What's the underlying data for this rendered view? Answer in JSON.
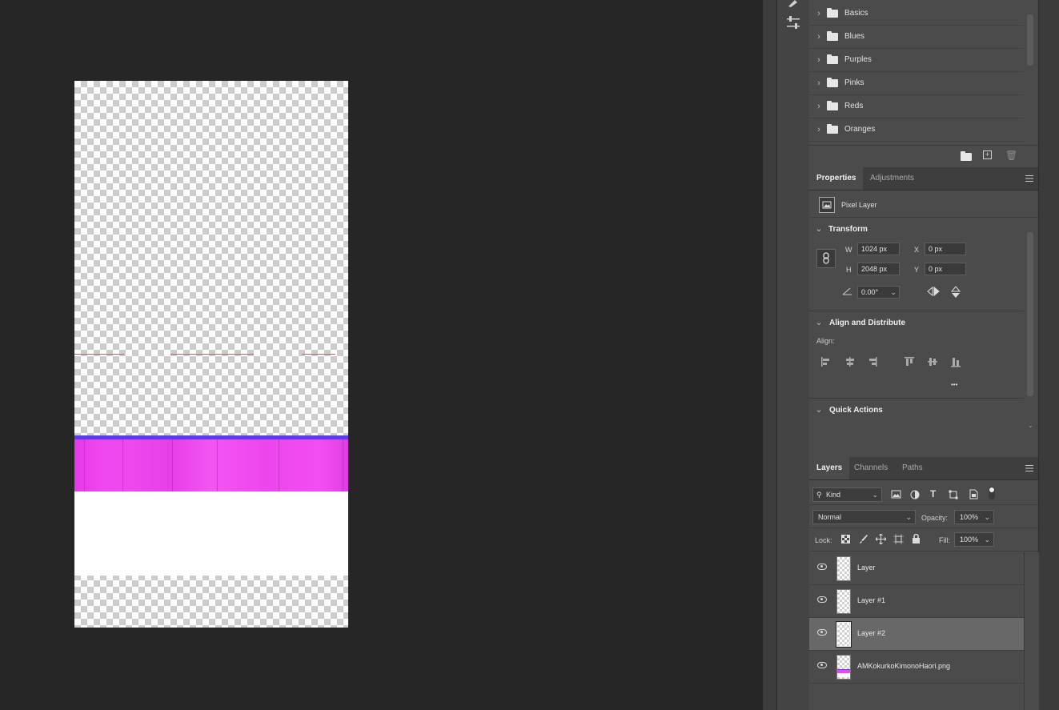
{
  "swatches": {
    "folders": [
      "Basics",
      "Blues",
      "Purples",
      "Pinks",
      "Reds",
      "Oranges"
    ]
  },
  "properties": {
    "tabs": [
      "Properties",
      "Adjustments"
    ],
    "layer_type": "Pixel Layer",
    "transform": {
      "title": "Transform",
      "w_label": "W",
      "w_value": "1024 px",
      "h_label": "H",
      "h_value": "2048 px",
      "x_label": "X",
      "x_value": "0 px",
      "y_label": "Y",
      "y_value": "0 px",
      "angle_value": "0.00°"
    },
    "align": {
      "title": "Align and Distribute",
      "align_label": "Align:",
      "more": "•••"
    },
    "quick_actions": "Quick Actions"
  },
  "layers": {
    "tabs": [
      "Layers",
      "Channels",
      "Paths"
    ],
    "filter_kind": "Kind",
    "blend_mode": "Normal",
    "opacity_label": "Opacity:",
    "opacity_value": "100%",
    "lock_label": "Lock:",
    "fill_label": "Fill:",
    "fill_value": "100%",
    "items": [
      {
        "name": "Layer",
        "selected": false
      },
      {
        "name": "Layer #1",
        "selected": false
      },
      {
        "name": "Layer #2",
        "selected": true
      },
      {
        "name": "AMKokurkoKimonoHaori.png",
        "selected": false
      }
    ]
  },
  "colors": {
    "canvas_bg": "#262626",
    "panel_bg": "#4b4b4b",
    "texture_pink": "#f046f0",
    "texture_blue": "#5a3cf0"
  }
}
